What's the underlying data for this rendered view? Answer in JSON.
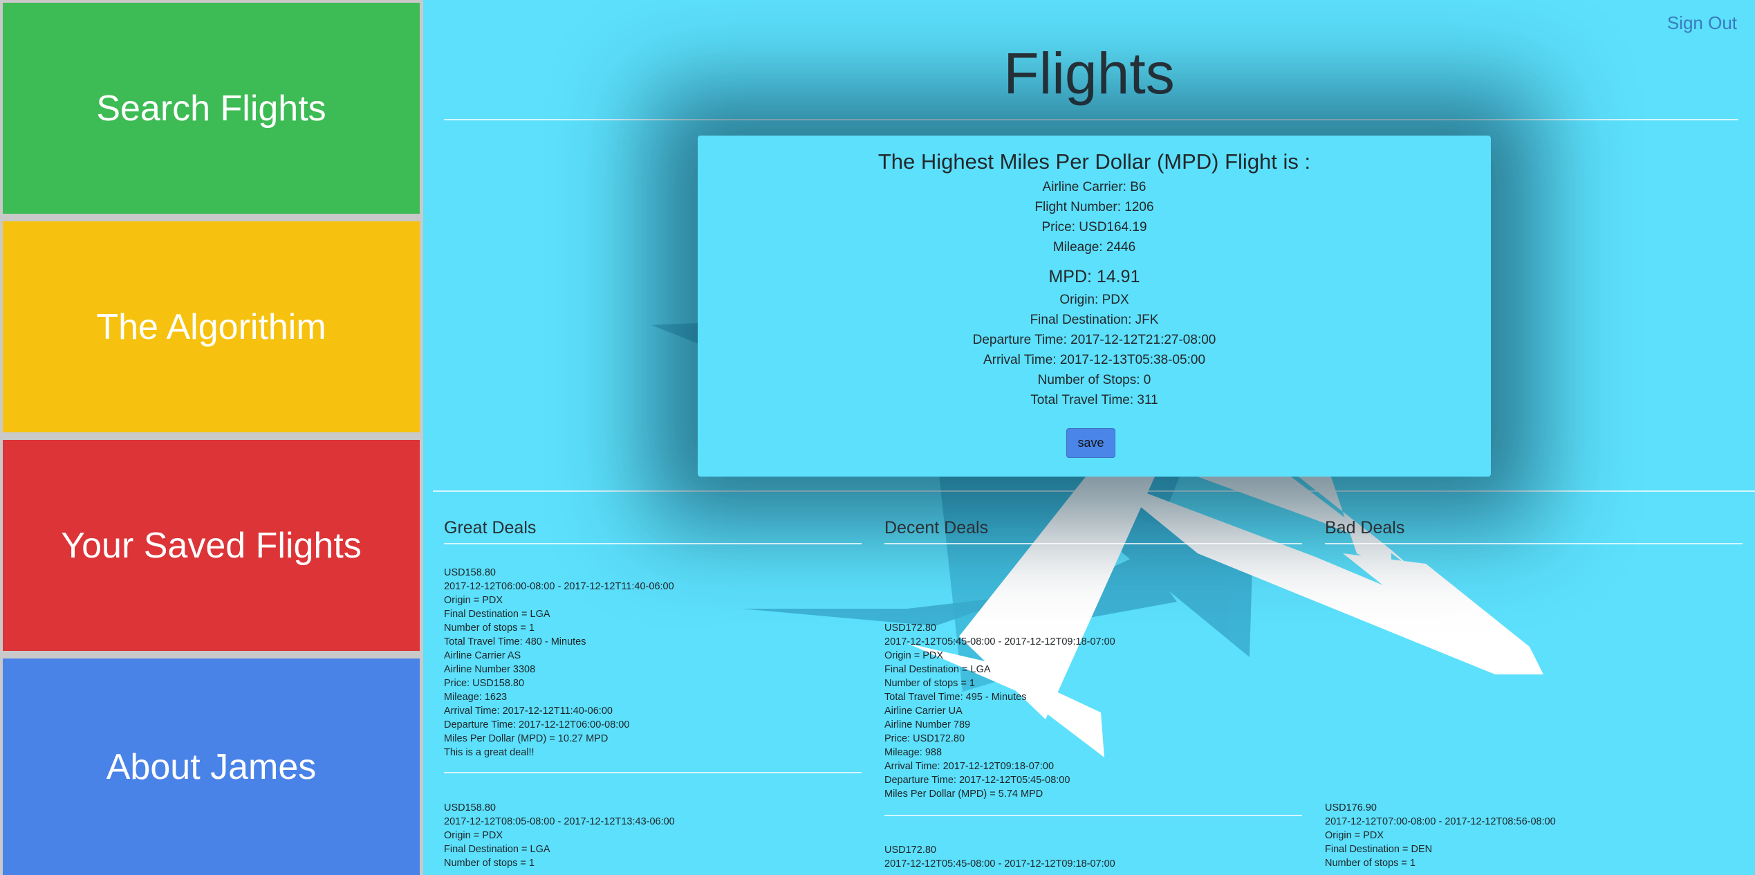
{
  "nav": {
    "items": [
      {
        "label": "Search Flights",
        "color": "#3dbb54"
      },
      {
        "label": "The Algorithim",
        "color": "#f6c20f"
      },
      {
        "label": "Your Saved Flights",
        "color": "#dc3437"
      },
      {
        "label": "About James",
        "color": "#4a83e8"
      }
    ]
  },
  "header": {
    "sign_out": "Sign Out",
    "title": "Flights"
  },
  "best": {
    "heading": "The Highest Miles Per Dollar (MPD) Flight is :",
    "carrier": "Airline Carrier: B6",
    "flight_number": "Flight Number: 1206",
    "price": "Price: USD164.19",
    "mileage": "Mileage: 2446",
    "mpd": "MPD: 14.91",
    "origin": "Origin: PDX",
    "destination": "Final Destination: JFK",
    "departure": "Departure Time: 2017-12-12T21:27-08:00",
    "arrival": "Arrival Time: 2017-12-13T05:38-05:00",
    "stops": "Number of Stops: 0",
    "travel_time": "Total Travel Time: 311",
    "save_label": "save"
  },
  "deals": {
    "great": {
      "title": "Great Deals",
      "items": [
        {
          "lines": [
            "USD158.80",
            "2017-12-12T06:00-08:00 - 2017-12-12T11:40-06:00",
            "Origin = PDX",
            "Final Destination = LGA",
            "Number of stops = 1",
            "Total Travel Time: 480 - Minutes",
            "Airline Carrier AS",
            "Airline Number 3308",
            "Price: USD158.80",
            "Mileage: 1623",
            "Arrival Time: 2017-12-12T11:40-06:00",
            "Departure Time: 2017-12-12T06:00-08:00",
            "Miles Per Dollar (MPD) = 10.27 MPD",
            "This is a great deal!!"
          ]
        },
        {
          "lines": [
            "USD158.80",
            "2017-12-12T08:05-08:00 - 2017-12-12T13:43-06:00",
            "Origin = PDX",
            "Final Destination = LGA",
            "Number of stops = 1"
          ]
        }
      ]
    },
    "decent": {
      "title": "Decent Deals",
      "items": [
        {
          "lines": [
            "USD172.80",
            "2017-12-12T05:45-08:00 - 2017-12-12T09:18-07:00",
            "Origin = PDX",
            "Final Destination = LGA",
            "Number of stops = 1",
            "Total Travel Time: 495 - Minutes",
            "Airline Carrier UA",
            "Airline Number 789",
            "Price: USD172.80",
            "Mileage: 988",
            "Arrival Time: 2017-12-12T09:18-07:00",
            "Departure Time: 2017-12-12T05:45-08:00",
            "Miles Per Dollar (MPD) = 5.74 MPD"
          ]
        },
        {
          "lines": [
            "USD172.80",
            "2017-12-12T05:45-08:00 - 2017-12-12T09:18-07:00"
          ]
        }
      ]
    },
    "bad": {
      "title": "Bad Deals",
      "items": [
        {
          "lines": [
            "USD176.90",
            "2017-12-12T07:00-08:00 - 2017-12-12T08:56-08:00",
            "Origin = PDX",
            "Final Destination = DEN",
            "Number of stops = 1"
          ]
        }
      ]
    }
  }
}
